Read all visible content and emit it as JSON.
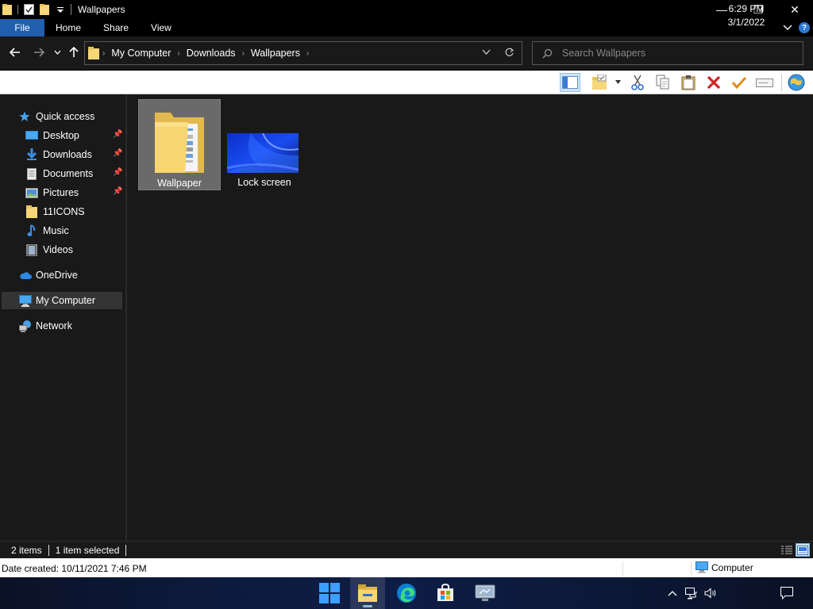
{
  "window": {
    "title": "Wallpapers",
    "buttons": {
      "minimize": "—",
      "maximize": "❐",
      "close": "✕"
    }
  },
  "ribbon": {
    "tabs": [
      "File",
      "Home",
      "Share",
      "View"
    ]
  },
  "address": {
    "crumbs": [
      "My Computer",
      "Downloads",
      "Wallpapers"
    ]
  },
  "search": {
    "placeholder": "Search Wallpapers"
  },
  "sidebar": {
    "quick_access": "Quick access",
    "items": [
      {
        "label": "Desktop",
        "pinned": true
      },
      {
        "label": "Downloads",
        "pinned": true
      },
      {
        "label": "Documents",
        "pinned": true
      },
      {
        "label": "Pictures",
        "pinned": true
      },
      {
        "label": "11ICONS",
        "pinned": false
      },
      {
        "label": "Music",
        "pinned": false
      },
      {
        "label": "Videos",
        "pinned": false
      }
    ],
    "onedrive": "OneDrive",
    "my_computer": "My Computer",
    "network": "Network"
  },
  "files": [
    {
      "name": "Wallpaper",
      "type": "folder",
      "selected": true
    },
    {
      "name": "Lock screen",
      "type": "image",
      "selected": false
    }
  ],
  "status": {
    "items": "2 items",
    "selected": "1 item selected"
  },
  "details": {
    "date_created": "Date created: 10/11/2021 7:46 PM",
    "location": "Computer"
  },
  "taskbar": {
    "time": "6:29 PM",
    "date": "3/1/2022"
  },
  "colors": {
    "accent": "#1f5fad",
    "background": "#191919",
    "selection": "#6a6a6a"
  }
}
